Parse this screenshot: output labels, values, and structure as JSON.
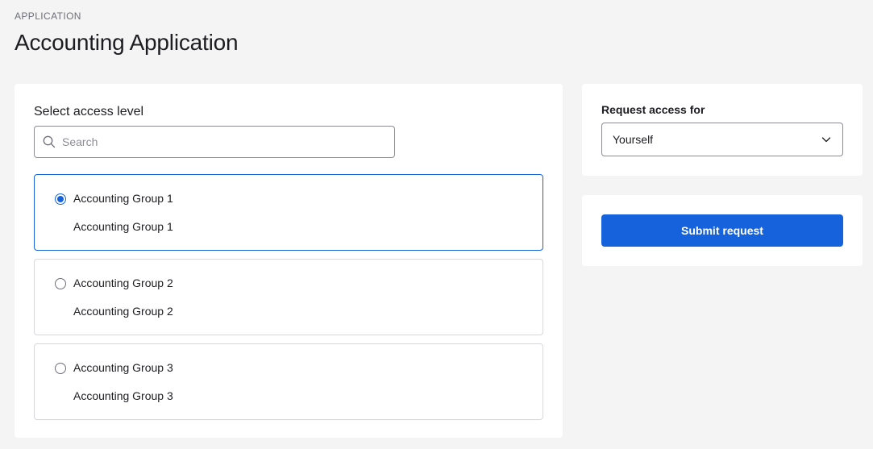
{
  "header": {
    "eyebrow": "APPLICATION",
    "title": "Accounting Application"
  },
  "access": {
    "label": "Select access level",
    "search": {
      "placeholder": "Search",
      "value": "",
      "icon": "search-icon"
    },
    "options": [
      {
        "title": "Accounting Group 1",
        "description": "Accounting Group 1",
        "selected": true
      },
      {
        "title": "Accounting Group 2",
        "description": "Accounting Group 2",
        "selected": false
      },
      {
        "title": "Accounting Group 3",
        "description": "Accounting Group 3",
        "selected": false
      }
    ]
  },
  "requester": {
    "label": "Request access for",
    "selected": "Yourself",
    "icon": "chevron-down-icon"
  },
  "actions": {
    "submit_label": "Submit request"
  },
  "colors": {
    "accent": "#1662dd",
    "background": "#f4f4f4",
    "card": "#ffffff"
  }
}
